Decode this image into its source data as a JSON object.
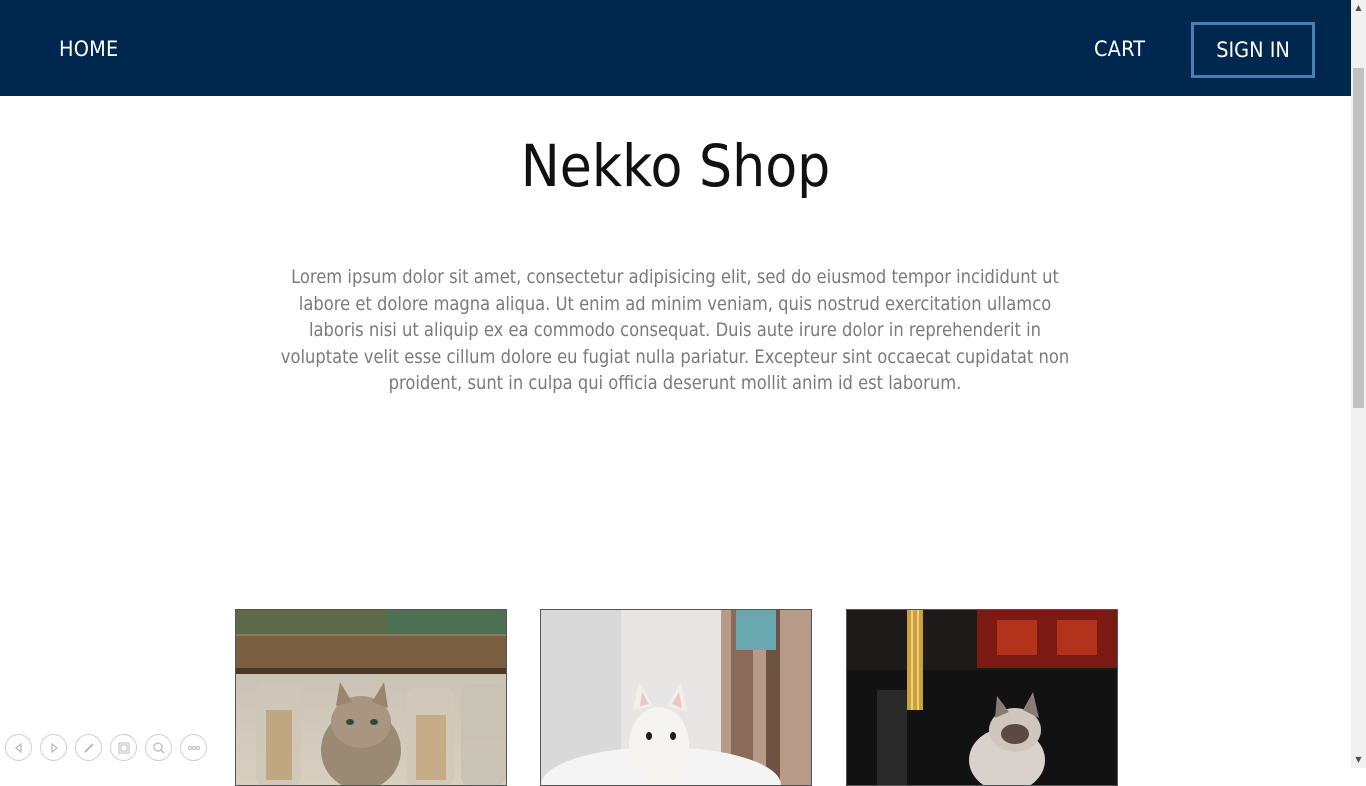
{
  "nav": {
    "home_label": "HOME",
    "cart_label": "CART",
    "signin_label": "SIGN IN"
  },
  "hero": {
    "title": "Nekko Shop",
    "description": "Lorem ipsum dolor sit amet, consectetur adipisicing elit, sed do eiusmod tempor incididunt ut labore et dolore magna aliqua. Ut enim ad minim veniam, quis nostrud exercitation ullamco laboris nisi ut aliquip ex ea commodo consequat. Duis aute irure dolor in reprehenderit in voluptate velit esse cillum dolore eu fugiat nulla pariatur. Excepteur sint occaecat cupidatat non proident, sunt in culpa qui officia deserunt mollit anim id est laborum."
  },
  "products": [
    {
      "image": "tabby cat among glass jars"
    },
    {
      "image": "white kitten at cafe table"
    },
    {
      "image": "cat in dark room with lamp"
    }
  ],
  "toolbar": {
    "icons": [
      "previous-icon",
      "next-icon",
      "pen-icon",
      "slides-icon",
      "zoom-icon",
      "more-icon"
    ]
  },
  "colors": {
    "nav_bg": "#00284f",
    "signin_border": "#4d7eb3",
    "text_muted": "#7a7a7a"
  }
}
